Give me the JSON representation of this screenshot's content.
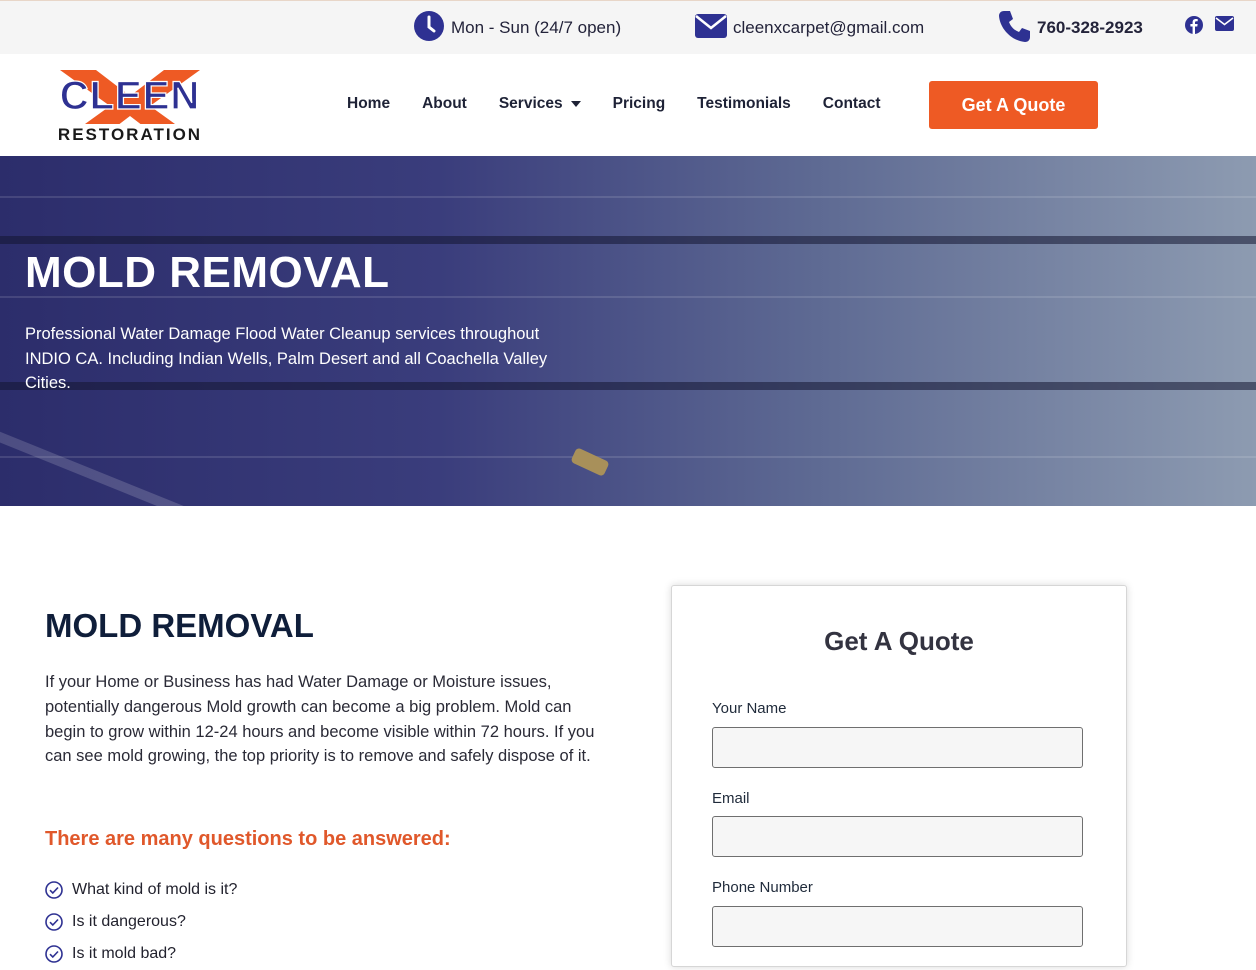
{
  "topbar": {
    "hours_icon": "clock-icon",
    "hours": "Mon - Sun (24/7 open)",
    "email_icon": "envelope-icon",
    "email": "cleenxcarpet@gmail.com",
    "phone_icon": "phone-icon",
    "phone": "760-328-2923",
    "social": [
      "facebook-icon",
      "envelope-icon"
    ]
  },
  "header": {
    "logo": {
      "word": "CLEEN",
      "letter": "X",
      "tagline": "RESTORATION"
    },
    "nav": [
      {
        "label": "Home"
      },
      {
        "label": "About"
      },
      {
        "label": "Services",
        "has_dropdown": true
      },
      {
        "label": "Pricing"
      },
      {
        "label": "Testimonials"
      },
      {
        "label": "Contact"
      }
    ],
    "cta": "Get A Quote"
  },
  "hero": {
    "title": "MOLD REMOVAL",
    "subtitle": "Professional Water Damage Flood Water Cleanup services throughout INDIO CA. Including Indian Wells, Palm Desert and all Coachella Valley Cities."
  },
  "content": {
    "title": "MOLD REMOVAL",
    "paragraph": "If your Home or Business has had Water Damage or Moisture issues, potentially dangerous Mold growth can become a big problem. Mold can begin to grow within 12-24 hours and become visible within 72 hours. If you can see mold growing, the top priority is to remove and safely dispose of it.",
    "questions_heading": "There are many questions to be answered:",
    "questions": [
      "What kind of mold is it?",
      "Is it dangerous?",
      "Is it mold bad?"
    ]
  },
  "form": {
    "title": "Get A Quote",
    "fields": [
      {
        "label": "Your Name",
        "value": ""
      },
      {
        "label": "Email",
        "value": ""
      },
      {
        "label": "Phone Number",
        "value": ""
      }
    ]
  },
  "colors": {
    "brand_navy": "#2e3192",
    "accent_orange": "#ee5a24",
    "heading_dark": "#0f1e3a"
  }
}
